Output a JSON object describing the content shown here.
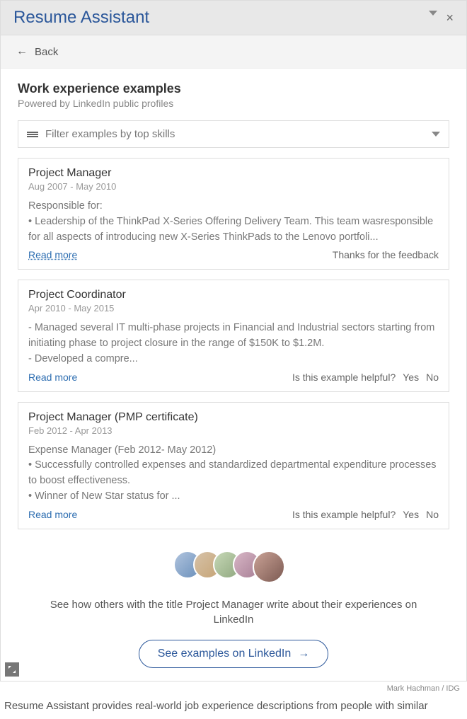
{
  "header": {
    "title": "Resume Assistant"
  },
  "back": {
    "label": "Back"
  },
  "section": {
    "title": "Work experience examples",
    "subtitle": "Powered by LinkedIn public profiles"
  },
  "filter": {
    "placeholder": "Filter examples by top skills"
  },
  "examples": [
    {
      "title": "Project Manager",
      "dates": "Aug 2007 - May 2010",
      "body": "Responsible for:\n• Leadership of the ThinkPad X-Series Offering Delivery Team. This team wasresponsible for all aspects of introducing new X-Series ThinkPads to the Lenovo portfoli...",
      "read_more": "Read more",
      "thanks": "Thanks for the feedback"
    },
    {
      "title": "Project Coordinator",
      "dates": "Apr 2010 - May 2015",
      "body": "- Managed several IT multi-phase projects in Financial and Industrial sectors starting from initiating phase to project closure in the range of $150K to $1.2M.\n- Developed a compre...",
      "read_more": "Read more",
      "helpful": "Is this example helpful?",
      "yes": "Yes",
      "no": "No"
    },
    {
      "title": "Project Manager (PMP certificate)",
      "dates": "Feb 2012 - Apr 2013",
      "body": "Expense Manager (Feb 2012- May 2012)\n• Successfully controlled expenses and standardized departmental expenditure processes to boost effectiveness.\n• Winner of New Star status for ...",
      "read_more": "Read more",
      "helpful": "Is this example helpful?",
      "yes": "Yes",
      "no": "No"
    }
  ],
  "promo": {
    "text": "See how others with the title Project Manager write about their experiences on LinkedIn",
    "button": "See examples on LinkedIn"
  },
  "credit": "Mark Hachman / IDG",
  "caption": "Resume Assistant provides real-world job experience descriptions from people with similar"
}
